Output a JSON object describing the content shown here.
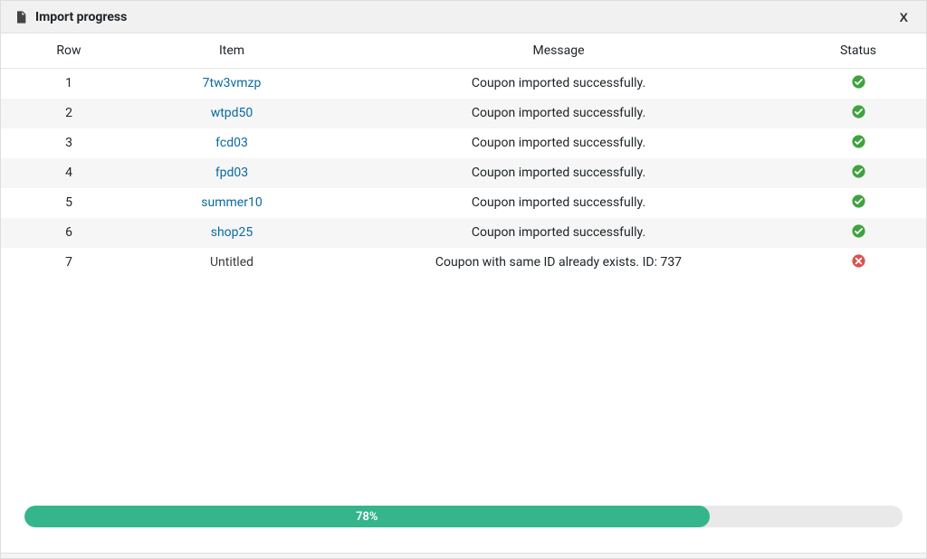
{
  "dialog": {
    "title": "Import progress",
    "close_label": "X"
  },
  "colors": {
    "link": "#0a6aa1",
    "success": "#3fa33f",
    "error": "#d9534f",
    "progress": "#35b58b"
  },
  "table": {
    "headers": {
      "row": "Row",
      "item": "Item",
      "message": "Message",
      "status": "Status"
    },
    "rows": [
      {
        "row": "1",
        "item": "7tw3vmzp",
        "is_link": true,
        "message": "Coupon imported successfully.",
        "status": "success"
      },
      {
        "row": "2",
        "item": "wtpd50",
        "is_link": true,
        "message": "Coupon imported successfully.",
        "status": "success"
      },
      {
        "row": "3",
        "item": "fcd03",
        "is_link": true,
        "message": "Coupon imported successfully.",
        "status": "success"
      },
      {
        "row": "4",
        "item": "fpd03",
        "is_link": true,
        "message": "Coupon imported successfully.",
        "status": "success"
      },
      {
        "row": "5",
        "item": "summer10",
        "is_link": true,
        "message": "Coupon imported successfully.",
        "status": "success"
      },
      {
        "row": "6",
        "item": "shop25",
        "is_link": true,
        "message": "Coupon imported successfully.",
        "status": "success"
      },
      {
        "row": "7",
        "item": "Untitled",
        "is_link": false,
        "message": "Coupon with same ID already exists. ID: 737",
        "status": "error"
      }
    ]
  },
  "progress": {
    "percent": 78,
    "label": "78%"
  }
}
